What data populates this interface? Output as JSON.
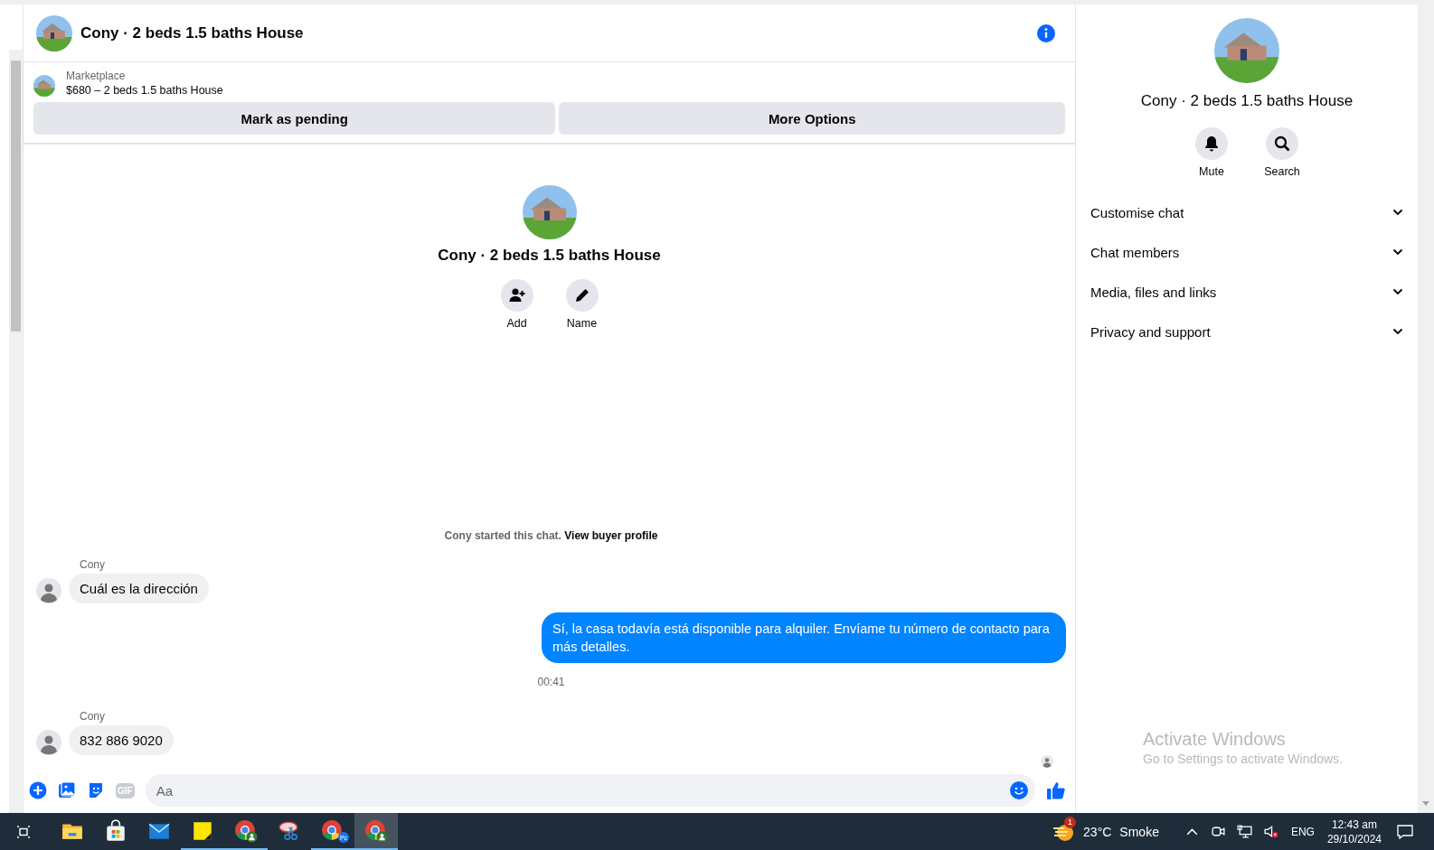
{
  "header": {
    "title": "Cony · 2 beds 1.5 baths House"
  },
  "listing": {
    "source": "Marketplace",
    "title": "$680 – 2 beds 1.5 baths House",
    "buttons": [
      "Mark as pending",
      "More Options"
    ]
  },
  "intro": {
    "title": "Cony · 2 beds 1.5 baths House",
    "actions": [
      {
        "kind": "add",
        "label": "Add"
      },
      {
        "kind": "name",
        "label": "Name"
      }
    ],
    "note": "Cony started this chat.",
    "link": "View buyer profile"
  },
  "messages": [
    {
      "kind": "incoming",
      "sender": "Cony",
      "text": "Cuál es la dirección"
    },
    {
      "kind": "outgoing",
      "text": "Sí, la casa todavía está disponible para alquiler. Envíame tu número de contacto para más detalles."
    },
    {
      "kind": "time",
      "text": "00:41"
    },
    {
      "kind": "incoming",
      "sender": "Cony",
      "text": "832 886 9020"
    }
  ],
  "composer": {
    "placeholder": "Aa",
    "gif_label": "GIF"
  },
  "details": {
    "title": "Cony · 2 beds 1.5 baths House",
    "actions": [
      {
        "kind": "mute",
        "label": "Mute"
      },
      {
        "kind": "search",
        "label": "Search"
      }
    ],
    "sections": [
      {
        "label": "Customise chat",
        "expanded": false
      },
      {
        "label": "Chat members",
        "expanded": false
      },
      {
        "label": "Media, files and links",
        "expanded": false
      },
      {
        "label": "Privacy and support",
        "expanded": false
      }
    ]
  },
  "activation": {
    "title": "Activate Windows",
    "subtitle": "Go to Settings to activate Windows."
  },
  "taskbar": {
    "apps": [
      {
        "kind": "files",
        "running": false,
        "selected": false
      },
      {
        "kind": "store",
        "running": false,
        "selected": false
      },
      {
        "kind": "mail",
        "running": false,
        "selected": false
      },
      {
        "kind": "notes",
        "running": true,
        "selected": false
      },
      {
        "kind": "browser",
        "running": true,
        "selected": false
      },
      {
        "kind": "snip",
        "running": false,
        "selected": false
      },
      {
        "kind": "browser",
        "running": true,
        "selected": false,
        "badge": "Pc"
      },
      {
        "kind": "browser",
        "running": true,
        "selected": true
      }
    ],
    "weather": {
      "badge": "1",
      "temperature": "23°C",
      "condition": "Smoke"
    },
    "language": "ENG",
    "time": "12:43 am",
    "date": "29/10/2024"
  }
}
